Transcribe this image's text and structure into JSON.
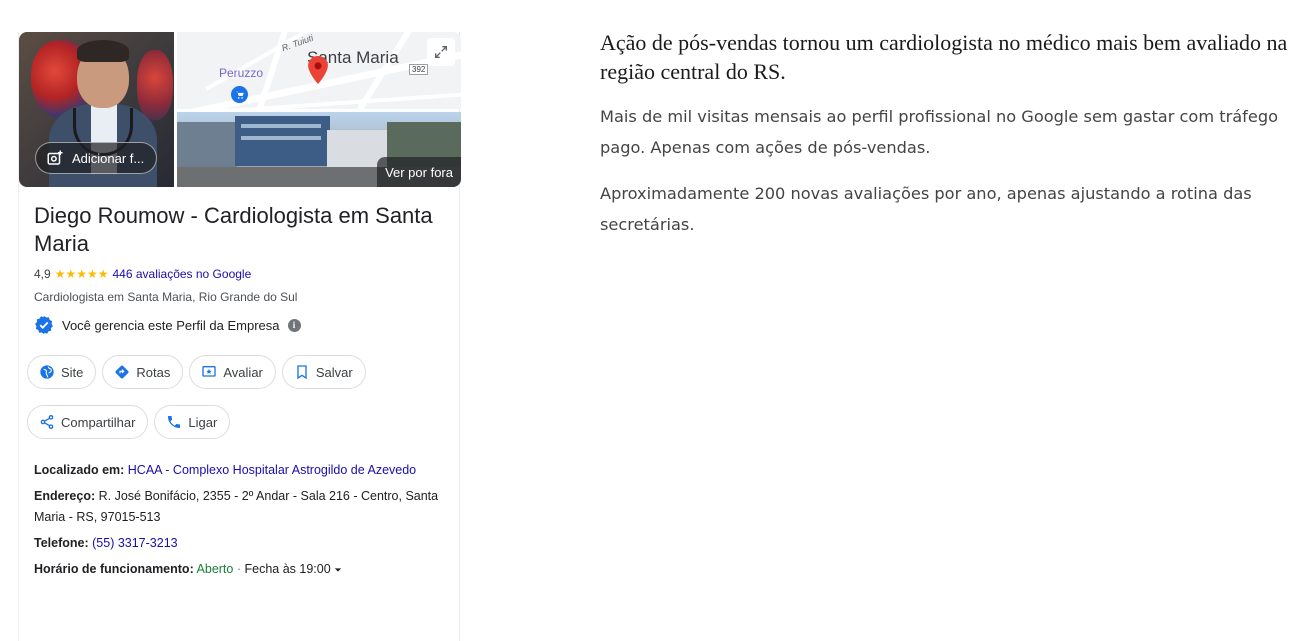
{
  "panel": {
    "add_photo_label": "Adicionar f...",
    "street_view_label": "Ver por fora",
    "map": {
      "street_label": "R. Tuiuti",
      "poi_label": "Peruzzo",
      "city_label": "Santa Maria",
      "route_badge": "392"
    },
    "title": "Diego Roumow - Cardiologista em Santa Maria",
    "rating": "4,9",
    "stars": "★★★★★",
    "reviews_link": "446 avaliações no Google",
    "category": "Cardiologista em Santa Maria, Rio Grande do Sul",
    "manage_text": "Você gerencia este Perfil da Empresa",
    "actions": {
      "site": "Site",
      "rotas": "Rotas",
      "avaliar": "Avaliar",
      "salvar": "Salvar",
      "compartilhar": "Compartilhar",
      "ligar": "Ligar"
    },
    "located_label": "Localizado em:",
    "located_value": "HCAA - Complexo Hospitalar Astrogildo de Azevedo",
    "address_label": "Endereço:",
    "address_value": "R. José Bonifácio, 2355 - 2º Andar - Sala 216 - Centro, Santa Maria - RS, 97015-513",
    "phone_label": "Telefone:",
    "phone_value": "(55) 3317-3213",
    "hours_label": "Horário de funcionamento:",
    "hours_status": "Aberto",
    "hours_sep": "·",
    "hours_close": "Fecha às 19:00"
  },
  "article": {
    "headline": "Ação de pós-vendas tornou um cardiologista no médico mais bem avaliado na região central do RS.",
    "paragraph_1": "Mais de mil visitas mensais ao perfil profissional no Google sem gastar com tráfego pago. Apenas com ações de pós-vendas.",
    "paragraph_2": "Aproximadamente 200 novas avaliações por ano, apenas ajustando a rotina das secretárias."
  },
  "colors": {
    "link": "#1a0dab",
    "open": "#188038",
    "star": "#fbbc04",
    "google_blue": "#1a73e8",
    "pin_red": "#ea4335"
  }
}
